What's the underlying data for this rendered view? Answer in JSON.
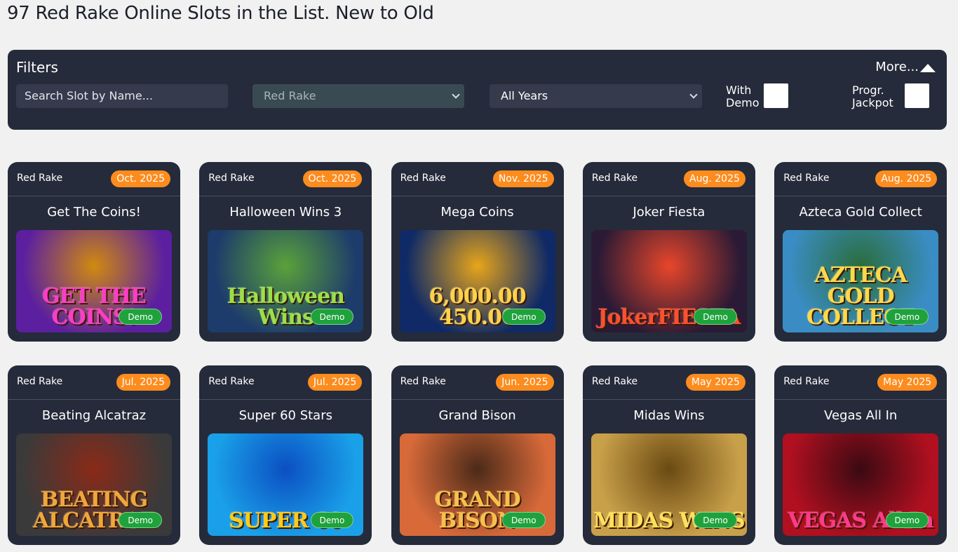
{
  "page": {
    "title": "97 Red Rake Online Slots in the List. New to Old"
  },
  "filters": {
    "title": "Filters",
    "more_label": "More...",
    "search_placeholder": "Search Slot by Name...",
    "provider_value": "Red Rake",
    "years_value": "All Years",
    "with_demo_label": "With\nDemo",
    "progr_jackpot_label": "Progr.\nJackpot"
  },
  "cards": [
    {
      "provider": "Red Rake",
      "date": "Oct. 2025",
      "title": "Get The Coins!",
      "art": "GET THE COINS!",
      "demo": "Demo",
      "bg": "#5b1fa0",
      "bg2": "#d08a10",
      "artColor": "#ff3cc8"
    },
    {
      "provider": "Red Rake",
      "date": "Oct. 2025",
      "title": "Halloween Wins 3",
      "art": "Halloween Wins",
      "demo": "Demo",
      "bg": "#1d3b6b",
      "bg2": "#5aa23a",
      "artColor": "#9be04a"
    },
    {
      "provider": "Red Rake",
      "date": "Nov. 2025",
      "title": "Mega Coins",
      "art": "6,000.00  450.00",
      "demo": "Demo",
      "bg": "#0f2a66",
      "bg2": "#e7a51a",
      "artColor": "#ffd24a"
    },
    {
      "provider": "Red Rake",
      "date": "Aug. 2025",
      "title": "Joker Fiesta",
      "art": "JokerFIESTA",
      "demo": "Demo",
      "bg": "#2a1a35",
      "bg2": "#e8462a",
      "artColor": "#ff4f2e"
    },
    {
      "provider": "Red Rake",
      "date": "Aug. 2025",
      "title": "Azteca Gold Collect",
      "art": "AZTECA GOLD COLLECT",
      "demo": "Demo",
      "bg": "#3a8dc4",
      "bg2": "#2a6d3b",
      "artColor": "#ffd84a"
    },
    {
      "provider": "Red Rake",
      "date": "Jul. 2025",
      "title": "Beating Alcatraz",
      "art": "BEATING ALCATRAZ",
      "demo": "Demo",
      "bg": "#3b3a3a",
      "bg2": "#8a2a18",
      "artColor": "#f0a63a"
    },
    {
      "provider": "Red Rake",
      "date": "Jul. 2025",
      "title": "Super 60 Stars",
      "art": "SUPER 60",
      "demo": "Demo",
      "bg": "#1aa0e8",
      "bg2": "#0b4fc2",
      "artColor": "#ffcb1a"
    },
    {
      "provider": "Red Rake",
      "date": "Jun. 2025",
      "title": "Grand Bison",
      "art": "GRAND BISON",
      "demo": "Demo",
      "bg": "#d86a3a",
      "bg2": "#4b2a18",
      "artColor": "#f7c04a"
    },
    {
      "provider": "Red Rake",
      "date": "May 2025",
      "title": "Midas Wins",
      "art": "MIDAS WINS",
      "demo": "Demo",
      "bg": "#c9a04a",
      "bg2": "#6a4a12",
      "artColor": "#ffe05a"
    },
    {
      "provider": "Red Rake",
      "date": "May 2025",
      "title": "Vegas All In",
      "art": "VEGAS All In",
      "demo": "Demo",
      "bg": "#b01020",
      "bg2": "#3a0a12",
      "artColor": "#ff3a8a"
    }
  ],
  "colors": {
    "accent": "#fd8c1e",
    "demo": "#1fa23c",
    "panel": "#252b3a"
  }
}
